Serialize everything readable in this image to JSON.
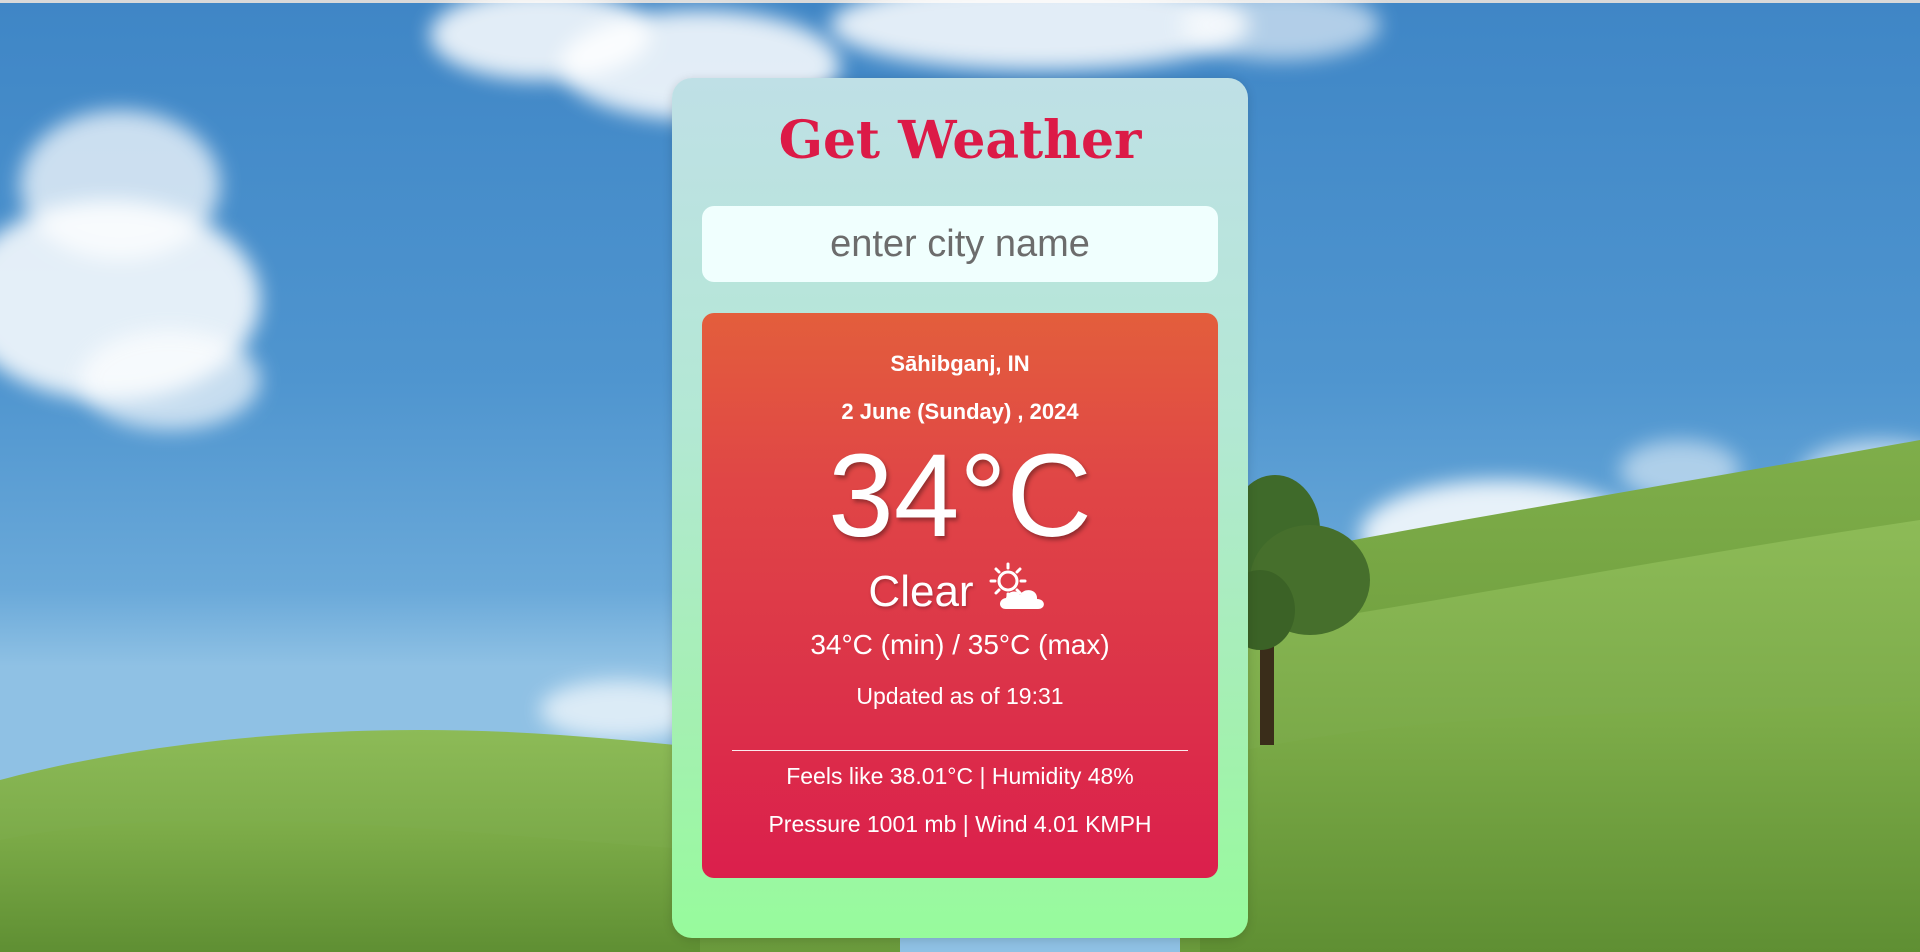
{
  "app": {
    "title": "Get Weather"
  },
  "search": {
    "placeholder": "enter city name",
    "value": ""
  },
  "weather": {
    "city": "Sāhibganj, IN",
    "date": "2 June (Sunday) , 2024",
    "temperature": "34°C",
    "condition": "Clear",
    "condition_icon": "sun-behind-cloud-icon",
    "min_max": "34°C (min) / 35°C (max)",
    "updated": "Updated as of 19:31",
    "feels_humidity": "Feels like 38.01°C | Humidity 48%",
    "pressure_wind": "Pressure 1001 mb | Wind 4.01 KMPH"
  },
  "colors": {
    "title": "#dc1a47",
    "card_top": "#bfe0e6",
    "card_bottom": "#97fb9c",
    "weather_top": "#e35e3c",
    "weather_bottom": "#db1f4c"
  }
}
